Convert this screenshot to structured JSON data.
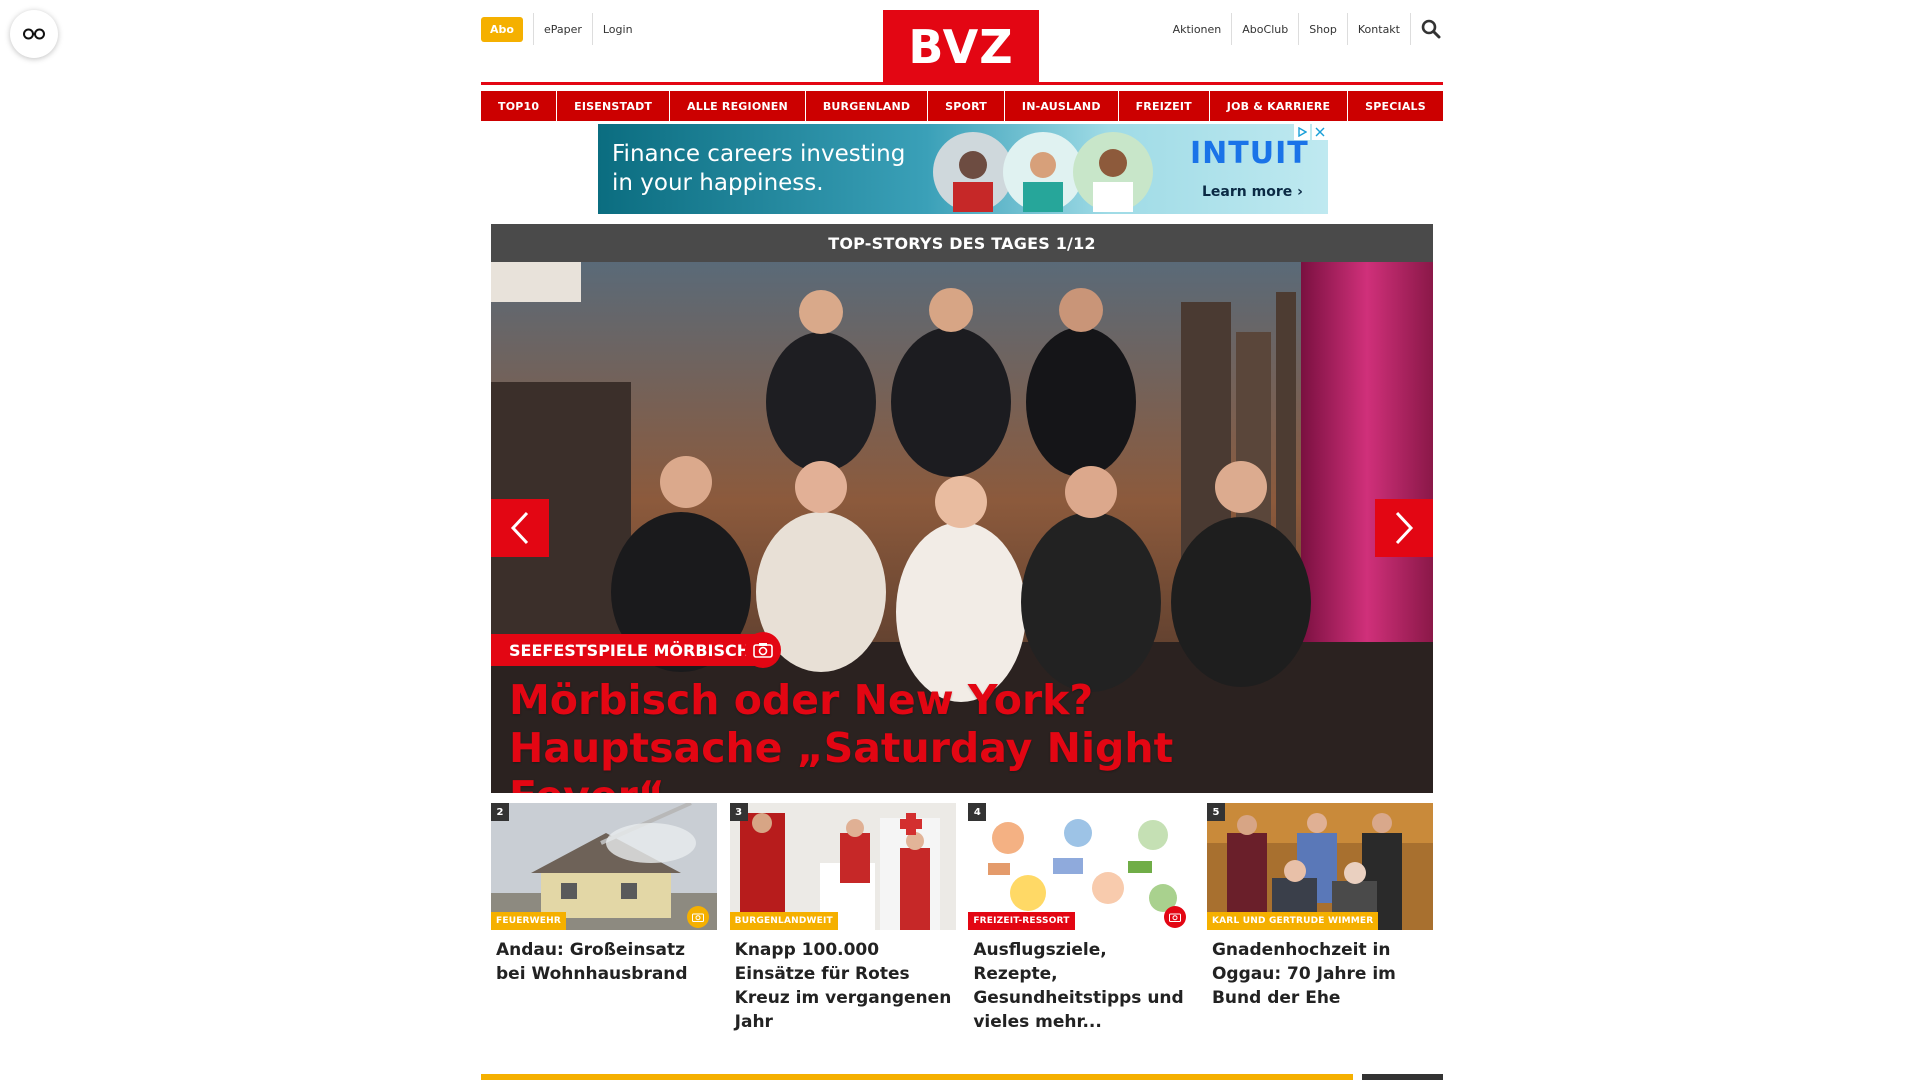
{
  "accessibility": {
    "icon": "glasses-icon"
  },
  "header": {
    "abo_label": "Abo",
    "left_links": [
      "ePaper",
      "Login"
    ],
    "logo_text": "BVZ",
    "right_links": [
      "Aktionen",
      "AboClub",
      "Shop",
      "Kontakt"
    ],
    "search_icon": "search-icon"
  },
  "nav": [
    "TOP10",
    "EISENSTADT",
    "ALLE REGIONEN",
    "BURGENLAND",
    "SPORT",
    "IN-AUSLAND",
    "FREIZEIT",
    "JOB & KARRIERE",
    "SPECIALS"
  ],
  "ad": {
    "line1": "Finance careers investing",
    "line2": "in your happiness.",
    "brand": "INTUIT",
    "cta": "Learn more ›"
  },
  "top_stories": {
    "heading": "TOP-STORYS DES TAGES 1/12",
    "hero": {
      "kicker": "SEEFESTSPIELE MÖRBISCH",
      "title": "Mörbisch oder New York? Hauptsache „Saturday Night Fever“"
    }
  },
  "articles": [
    {
      "number": "2",
      "category": "FEUERWEHR",
      "title": "Andau: Großeinsatz bei Wohnhausbrand"
    },
    {
      "number": "3",
      "category": "BURGENLANDWEIT",
      "title": "Knapp 100.000 Einsätze für Rotes Kreuz im vergangenen Jahr"
    },
    {
      "number": "4",
      "category": "FREIZEIT-RESSORT",
      "title": "Ausflugsziele, Rezepte, Gesundheitstipps und vieles mehr..."
    },
    {
      "number": "5",
      "category": "KARL UND GERTRUDE WIMMER",
      "title": "Gnadenhochzeit in Oggau: 70 Jahre im Bund der Ehe"
    }
  ],
  "colors": {
    "brand_red": "#e30613",
    "accent_gold": "#f5b000",
    "header_gray": "#4a4a4a"
  }
}
